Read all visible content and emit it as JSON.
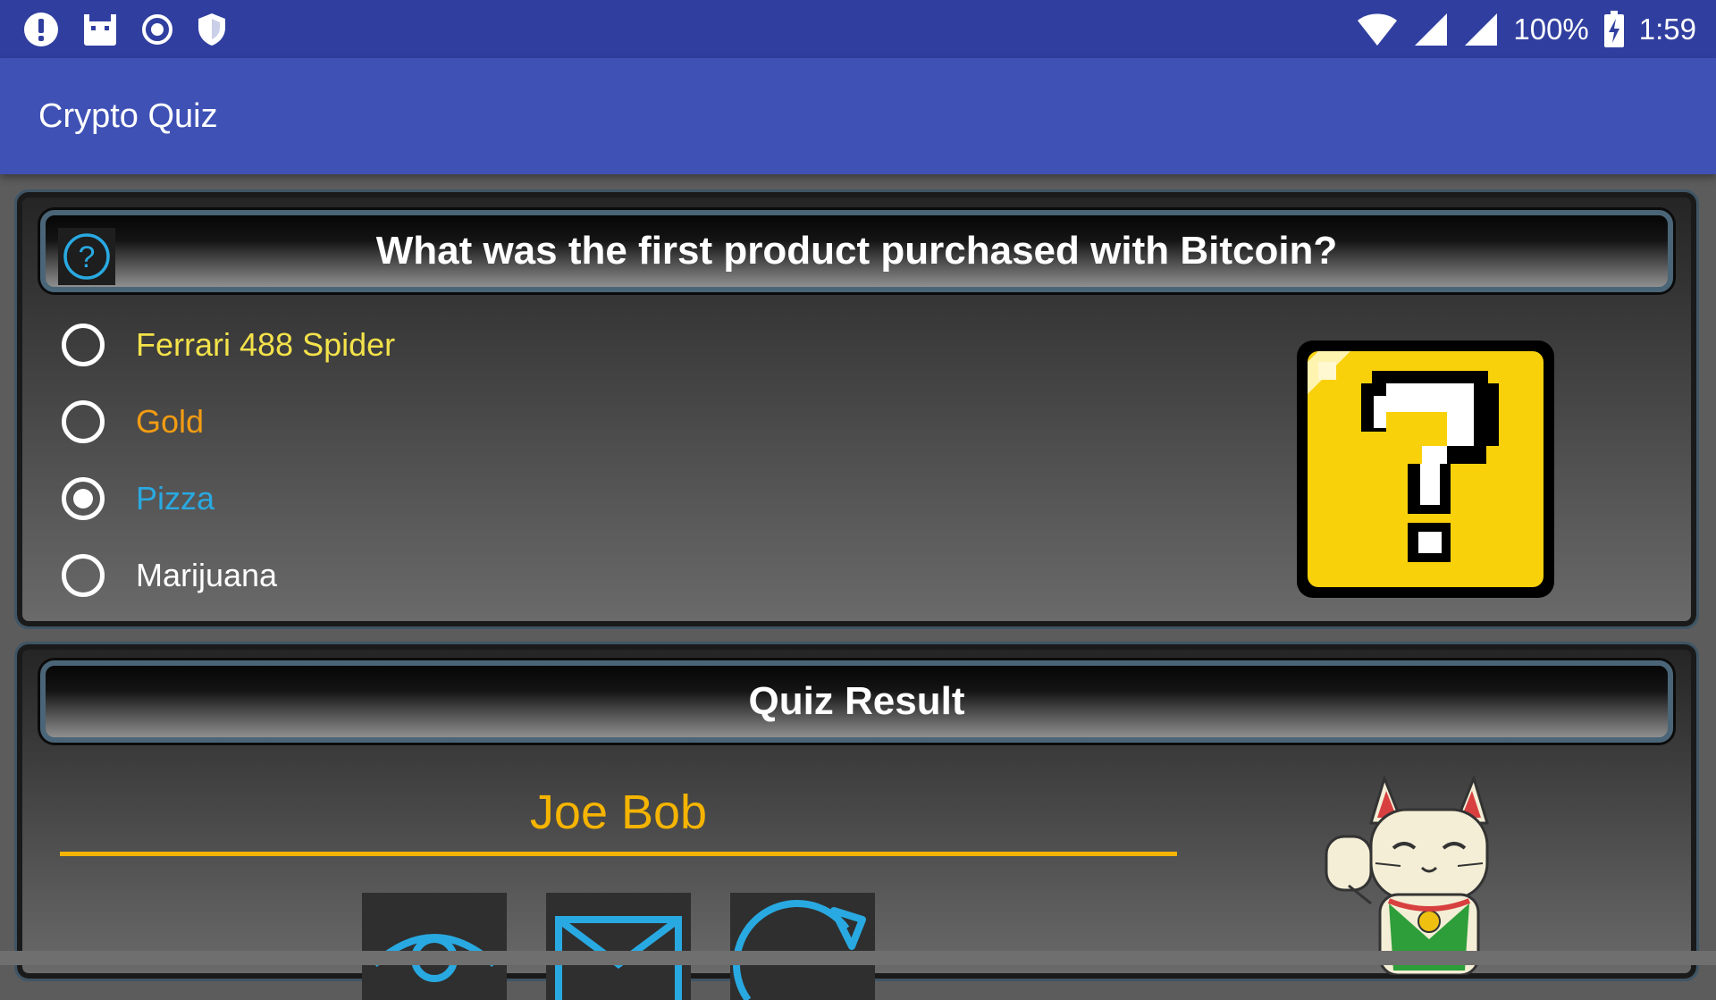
{
  "status_bar": {
    "battery": "100%",
    "time": "1:59",
    "left_icons": [
      "alert-icon",
      "android-debug-icon",
      "record-icon",
      "shield-icon"
    ],
    "right_icons": [
      "wifi-icon",
      "signal-icon",
      "signal-icon",
      "battery-charging-icon"
    ]
  },
  "app_bar": {
    "title": "Crypto Quiz"
  },
  "question_card": {
    "help_icon": "help-circle-icon",
    "question": "What was the first product purchased with Bitcoin?",
    "options": [
      {
        "label": "Ferrari 488 Spider",
        "color": "#f3e24a",
        "selected": false
      },
      {
        "label": "Gold",
        "color": "#f39c12",
        "selected": false
      },
      {
        "label": "Pizza",
        "color": "#29a9e1",
        "selected": true
      },
      {
        "label": "Marijuana",
        "color": "#ffffff",
        "selected": false
      }
    ],
    "image": "question-block-icon"
  },
  "result_card": {
    "header": "Quiz Result",
    "name": "Joe Bob",
    "buttons": [
      "view-icon",
      "email-icon",
      "refresh-icon"
    ],
    "image": "lucky-cat-icon"
  },
  "colors": {
    "status_bar": "#303f9f",
    "app_bar": "#3f51b5",
    "accent": "#f5b400",
    "icon_blue": "#29a9e1"
  }
}
